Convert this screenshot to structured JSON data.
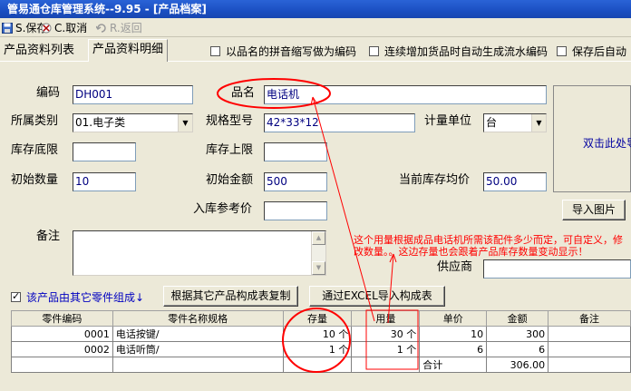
{
  "window": {
    "title": "管易通仓库管理系统--9.95 - [产品档案]"
  },
  "toolbar": {
    "save": "S.保存",
    "cancel": "C.取消",
    "undo": "R.返回"
  },
  "tabs": [
    {
      "label": "产品资料列表"
    },
    {
      "label": "产品资料明细"
    }
  ],
  "options": {
    "pinyin_code": "以品名的拼音缩写做为编码",
    "auto_serial": "连续增加货品时自动生成流水编码",
    "auto_save": "保存后自动"
  },
  "form": {
    "code_label": "编码",
    "code_value": "DH001",
    "name_label": "品名",
    "name_value": "电话机",
    "category_label": "所属类别",
    "category_value": "01.电子类",
    "spec_label": "规格型号",
    "spec_value": "42*33*12",
    "unit_label": "计量单位",
    "unit_value": "台",
    "stock_min_label": "库存底限",
    "stock_min_value": "",
    "stock_max_label": "库存上限",
    "stock_max_value": "",
    "init_qty_label": "初始数量",
    "init_qty_value": "10",
    "init_amount_label": "初始金额",
    "init_amount_value": "500",
    "avg_price_label": "当前库存均价",
    "avg_price_value": "50.00",
    "ref_price_label": "入库参考价",
    "ref_price_value": "",
    "remark_label": "备注",
    "supplier_label": "供应商",
    "supplier_value": "",
    "image_hint": "双击此处导",
    "import_image": "导入图片"
  },
  "annotation": "这个用量根据成品电话机所需该配件多少而定，可自定义，修改数量。。这边存量也会跟着产品库存数量变动显示！",
  "composition": {
    "checkbox_label": "该产品由其它零件组成↓",
    "copy_button": "根据其它产品构成表复制",
    "excel_button": "通过EXCEL导入构成表"
  },
  "parts_table": {
    "columns": [
      "零件编码",
      "零件名称规格",
      "存量",
      "用量",
      "单价",
      "金额",
      "备注"
    ],
    "rows": [
      {
        "code": "0001",
        "name": "电话按键/",
        "stock": "10 个",
        "usage": "30 个",
        "price": "10",
        "amount": "300",
        "remark": ""
      },
      {
        "code": "0002",
        "name": "电话听筒/",
        "stock": "1 个",
        "usage": "1 个",
        "price": "6",
        "amount": "6",
        "remark": ""
      }
    ],
    "total_label": "合计",
    "total_amount": "306.00"
  },
  "colors": {
    "annotation": "#ff0000",
    "title_bar": "#2a63d6",
    "value_text": "#000080"
  }
}
